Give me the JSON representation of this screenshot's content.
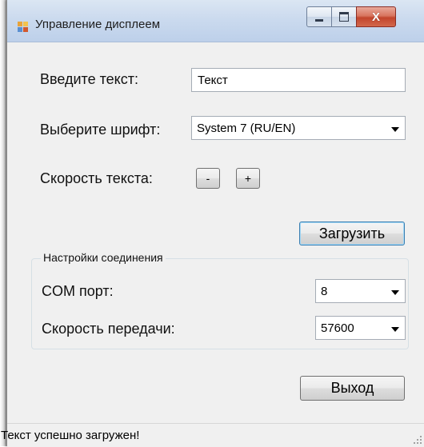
{
  "window": {
    "title": "Управление дисплеем",
    "controls": {
      "minimize": "minimize",
      "maximize": "maximize",
      "close": "X"
    }
  },
  "form": {
    "text_label": "Введите текст:",
    "text_value": "Текст",
    "font_label": "Выберите шрифт:",
    "font_selected": "System 7 (RU/EN)",
    "speed_label": "Скорость текста:",
    "speed_minus": "-",
    "speed_plus": "+",
    "upload_button": "Загрузить"
  },
  "connection": {
    "group_title": "Настройки соединения",
    "com_label": "COM порт:",
    "com_selected": "8",
    "baud_label": "Скорость передачи:",
    "baud_selected": "57600"
  },
  "exit_button": "Выход",
  "status": {
    "text": "Текст успешно загружен!"
  },
  "icons": [
    "app-icon",
    "minimize-icon",
    "maximize-icon",
    "close-icon",
    "dropdown-arrow-icon",
    "resize-grip-icon"
  ],
  "colors": {
    "titlebar": "#cbdaee",
    "close_button": "#c2452c",
    "window_bg": "#f0f0f0"
  }
}
